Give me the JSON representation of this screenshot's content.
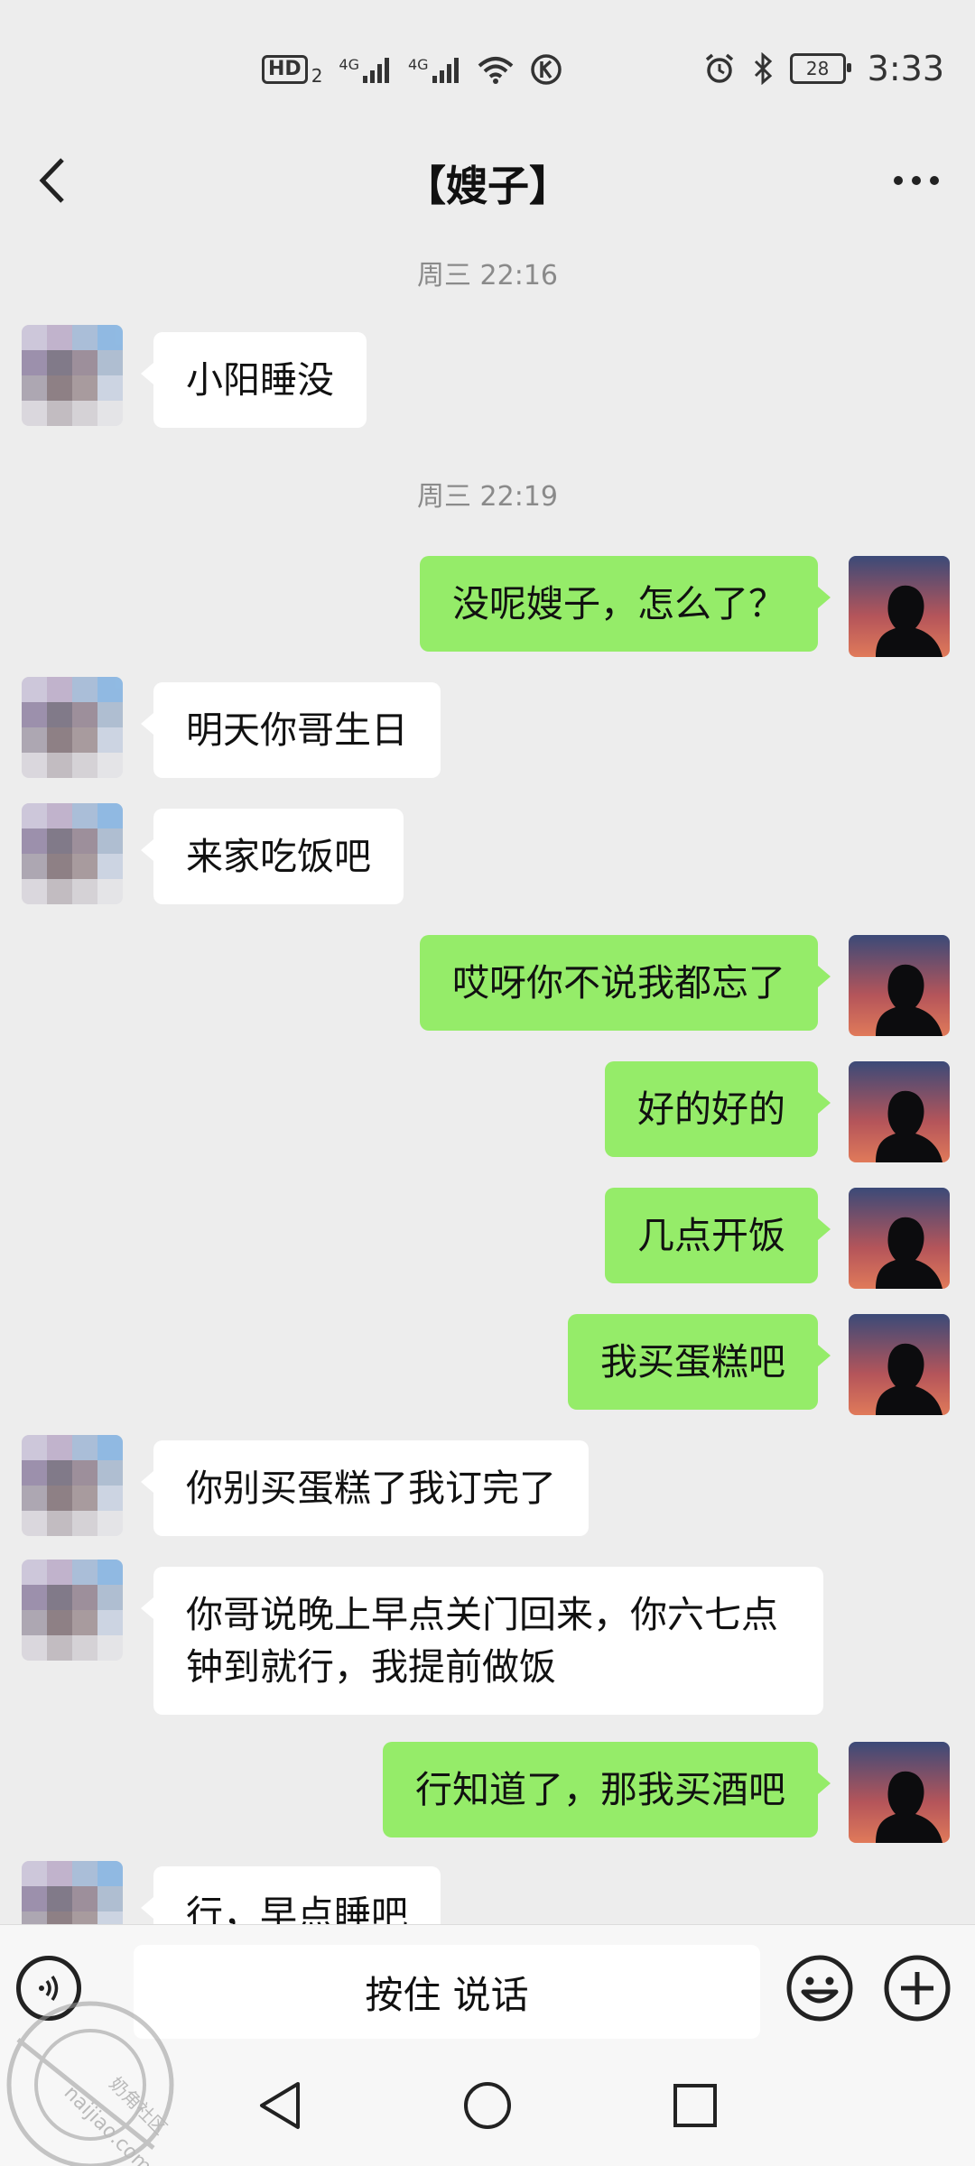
{
  "status_bar": {
    "hd_label": "HD",
    "sim_label": "2",
    "network_1": "4G",
    "network_2": "4G",
    "battery": "28",
    "time": "3:33"
  },
  "header": {
    "title": "【嫂子】"
  },
  "messages": [
    {
      "type": "time",
      "text": "周三 22:16"
    },
    {
      "side": "left",
      "text": "小阳睡没"
    },
    {
      "type": "time",
      "text": "周三 22:19"
    },
    {
      "side": "right",
      "text": "没呢嫂子，怎么了？"
    },
    {
      "side": "left",
      "text": "明天你哥生日"
    },
    {
      "side": "left",
      "text": "来家吃饭吧"
    },
    {
      "side": "right",
      "text": "哎呀你不说我都忘了"
    },
    {
      "side": "right",
      "text": "好的好的"
    },
    {
      "side": "right",
      "text": "几点开饭"
    },
    {
      "side": "right",
      "text": "我买蛋糕吧"
    },
    {
      "side": "left",
      "text": "你别买蛋糕了我订完了"
    },
    {
      "side": "left",
      "text": "你哥说晚上早点关门回来，你六七点钟到就行，我提前做饭"
    },
    {
      "side": "right",
      "text": "行知道了，那我买酒吧"
    },
    {
      "side": "left",
      "text": "行，早点睡吧"
    }
  ],
  "input_bar": {
    "hold_to_talk": "按住 说话"
  },
  "watermark": {
    "text": "naijiao.com",
    "cn_text": "奶角社区"
  },
  "icons": {
    "back": "chevron-left-icon",
    "more": "more-dots-icon",
    "voice": "voice-icon",
    "emoji": "emoji-icon",
    "plus": "plus-icon",
    "nav_back": "triangle-back-icon",
    "nav_home": "circle-home-icon",
    "nav_recents": "square-recents-icon"
  }
}
